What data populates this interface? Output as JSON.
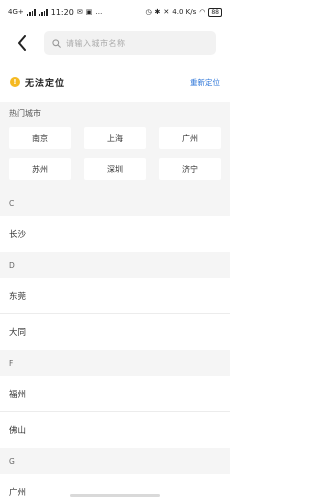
{
  "status": {
    "network": "4G+",
    "time": "11:20",
    "speed": "4.0 K/s",
    "battery": "88"
  },
  "search": {
    "placeholder": "请输入城市名称"
  },
  "location": {
    "status_text": "无法定位",
    "relocate_label": "重新定位",
    "warning_symbol": "!"
  },
  "hot": {
    "title": "热门城市",
    "cities": [
      "南京",
      "上海",
      "广州",
      "苏州",
      "深圳",
      "济宁"
    ]
  },
  "sections": [
    {
      "letter": "C",
      "cities": [
        "长沙"
      ]
    },
    {
      "letter": "D",
      "cities": [
        "东莞",
        "大同"
      ]
    },
    {
      "letter": "F",
      "cities": [
        "福州",
        "佛山"
      ]
    },
    {
      "letter": "G",
      "cities": [
        "广州"
      ]
    }
  ],
  "colors": {
    "accent": "#2b74d8",
    "warning": "#f5b921",
    "section_bg": "#f5f5f5"
  }
}
